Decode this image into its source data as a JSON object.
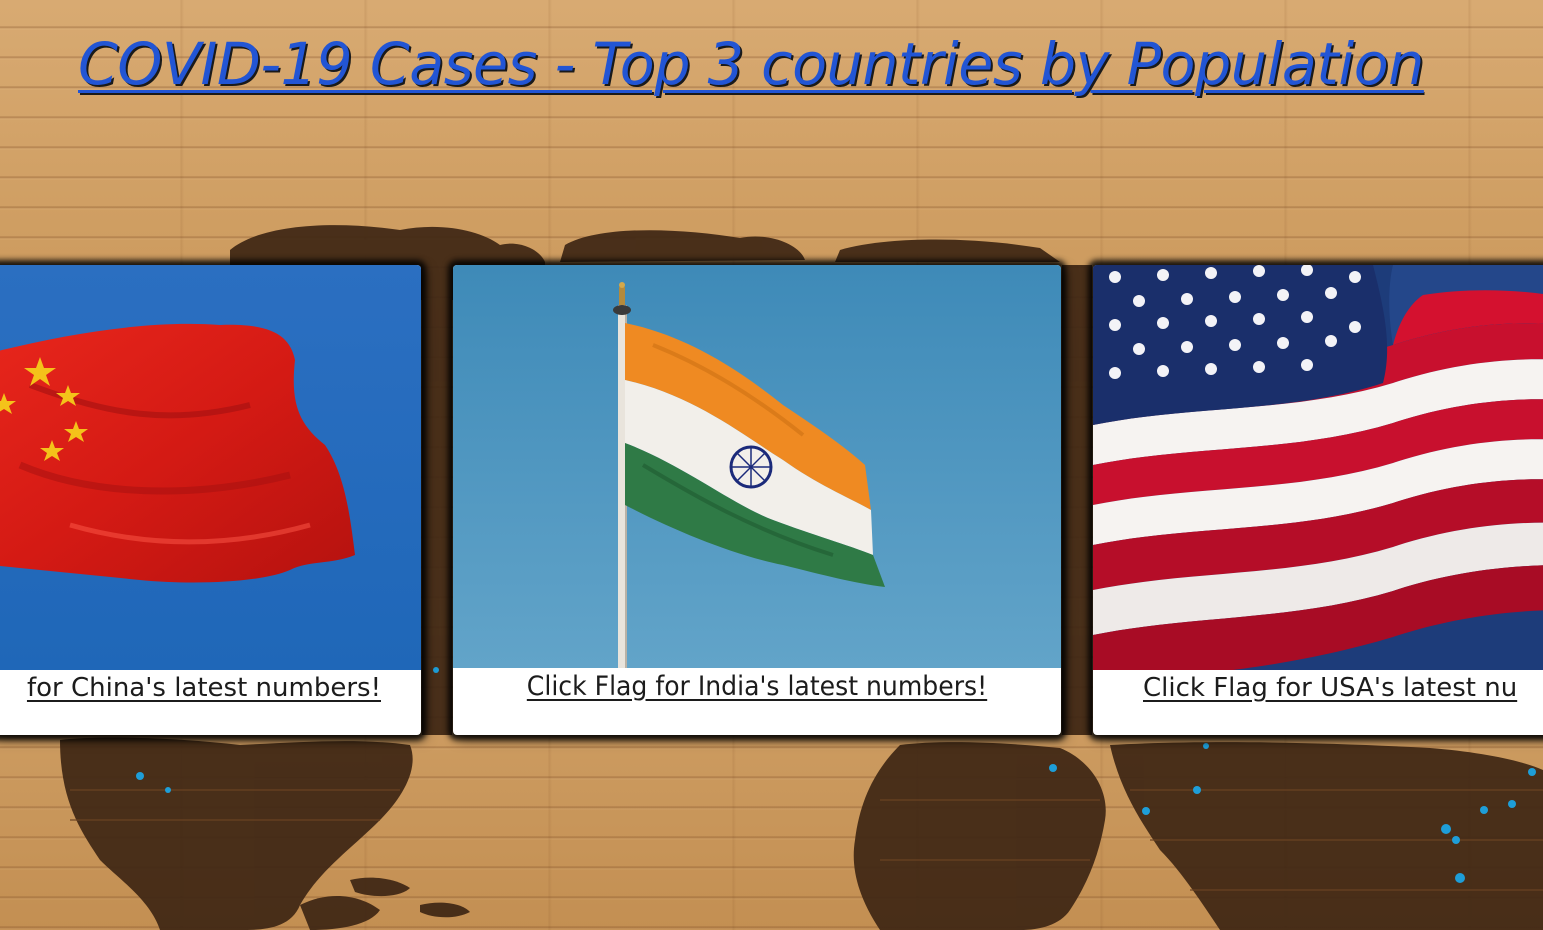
{
  "page": {
    "title": "COVID-19 Cases - Top 3 countries by Population"
  },
  "cards": [
    {
      "country": "China",
      "caption": "for China's latest numbers!",
      "flag_icon": "china-flag-photo"
    },
    {
      "country": "India",
      "caption": "Click Flag for India's latest numbers!",
      "flag_icon": "india-flag-photo"
    },
    {
      "country": "USA",
      "caption": "Click Flag for USA's latest nu",
      "flag_icon": "usa-flag-photo"
    }
  ],
  "colors": {
    "title": "#2255d4",
    "card_background": "#ffffff",
    "caption_text": "#1c1c1c",
    "wood": "#c99658",
    "map": "#3e2614"
  }
}
